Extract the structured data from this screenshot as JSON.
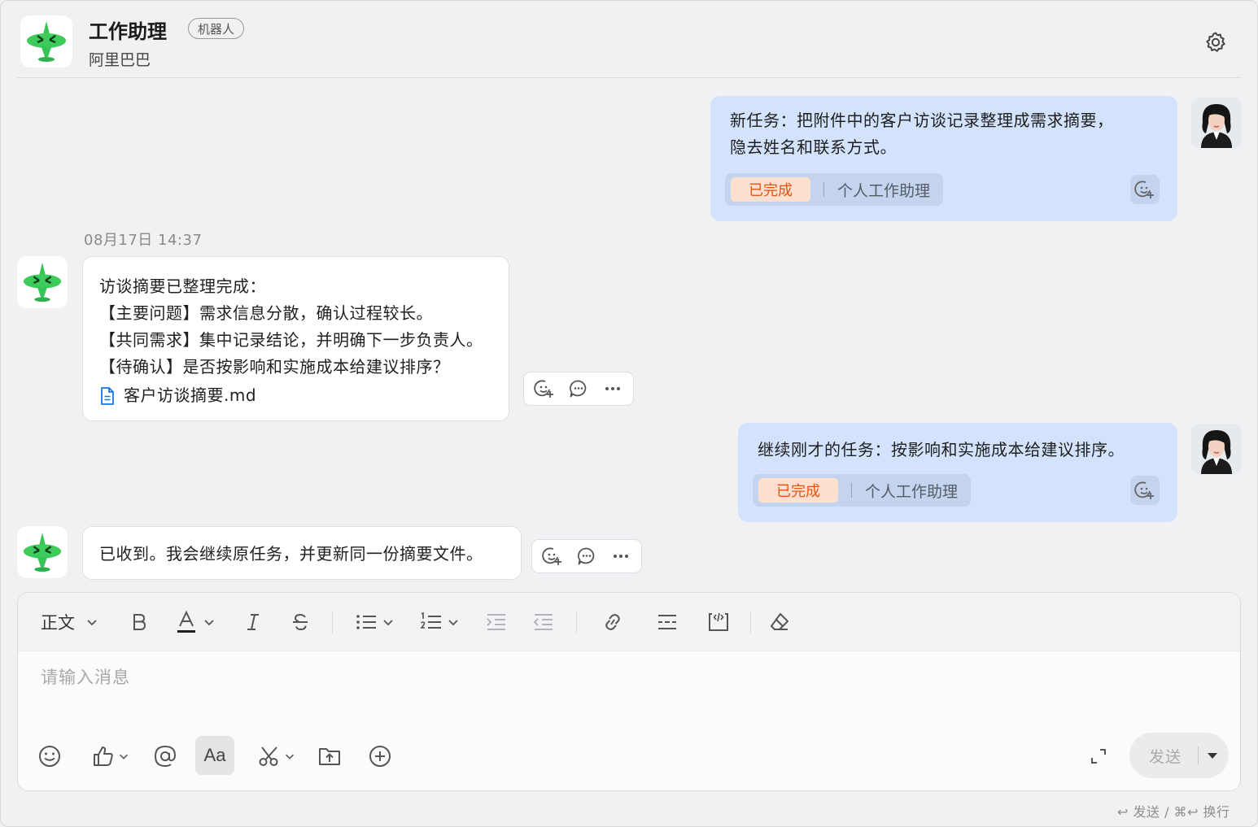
{
  "header": {
    "title": "工作助理",
    "tag": "机器人",
    "subtitle": "阿里巴巴",
    "settings_icon": "gear-icon"
  },
  "messages": [
    {
      "sender": "user",
      "lines": [
        "新任务：把附件中的客户访谈记录整理成需求摘要，",
        "隐去姓名和联系方式。"
      ],
      "status": "已完成",
      "owner": "个人工作助理"
    },
    {
      "sender": "bot",
      "timestamp": "08月17日 14:37",
      "lines": [
        "访谈摘要已整理完成：",
        "【主要问题】需求信息分散，确认过程较长。",
        "【共同需求】集中记录结论，并明确下一步负责人。",
        "【待确认】是否按影响和实施成本给建议排序？"
      ],
      "attachment": "客户访谈摘要.md"
    },
    {
      "sender": "user",
      "lines": [
        "继续刚才的任务：按影响和实施成本给建议排序。"
      ],
      "status": "已完成",
      "owner": "个人工作助理"
    },
    {
      "sender": "bot",
      "lines": [
        "已收到。我会继续原任务，并更新同一份摘要文件。"
      ]
    }
  ],
  "composer": {
    "text_style": "正文",
    "placeholder": "请输入消息",
    "send_label": "发送",
    "shortcut_hint": "↩ 发送 / ⌘↩ 换行",
    "font_button": "Aa"
  },
  "colors": {
    "user_bubble": "#d3e3fd",
    "status_done_text": "#e8540f",
    "status_done_bg": "#fde0cf",
    "link": "#1677e8",
    "bot_brand": "#3dcc5c"
  }
}
